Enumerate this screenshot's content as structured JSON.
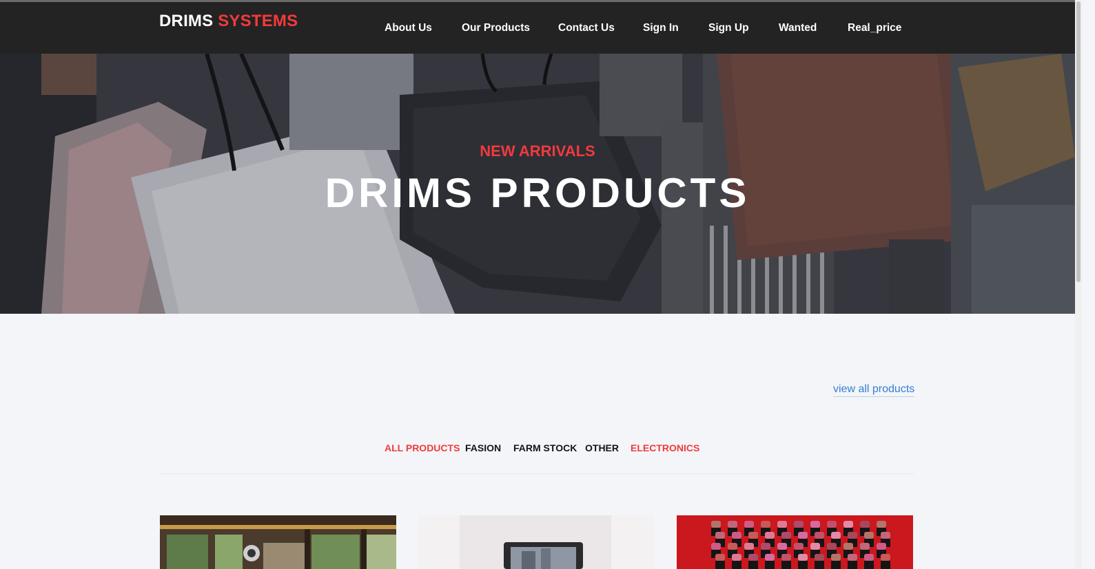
{
  "brand": {
    "part1": "DRIMS",
    "part2": "SYSTEMS"
  },
  "nav": {
    "items": [
      {
        "label": "About Us"
      },
      {
        "label": "Our Products"
      },
      {
        "label": "Contact Us"
      },
      {
        "label": "Sign In"
      },
      {
        "label": "Sign Up"
      },
      {
        "label": "Wanted"
      },
      {
        "label": "Real_price"
      }
    ]
  },
  "hero": {
    "kicker": "NEW ARRIVALS",
    "title": "DRIMS PRODUCTS"
  },
  "products": {
    "view_all": "view all products",
    "filters": [
      {
        "label": "ALL PRODUCTS",
        "active": true
      },
      {
        "label": "FASION",
        "active": false
      },
      {
        "label": "FARM STOCK",
        "active": false
      },
      {
        "label": "OTHER",
        "active": false
      },
      {
        "label": "ELECTRONICS",
        "active": true
      }
    ]
  },
  "colors": {
    "navbar": "#232323",
    "accent_red": "#f23a3c",
    "link_blue": "#2f7fd6",
    "page_bg": "#f4f5f8"
  }
}
